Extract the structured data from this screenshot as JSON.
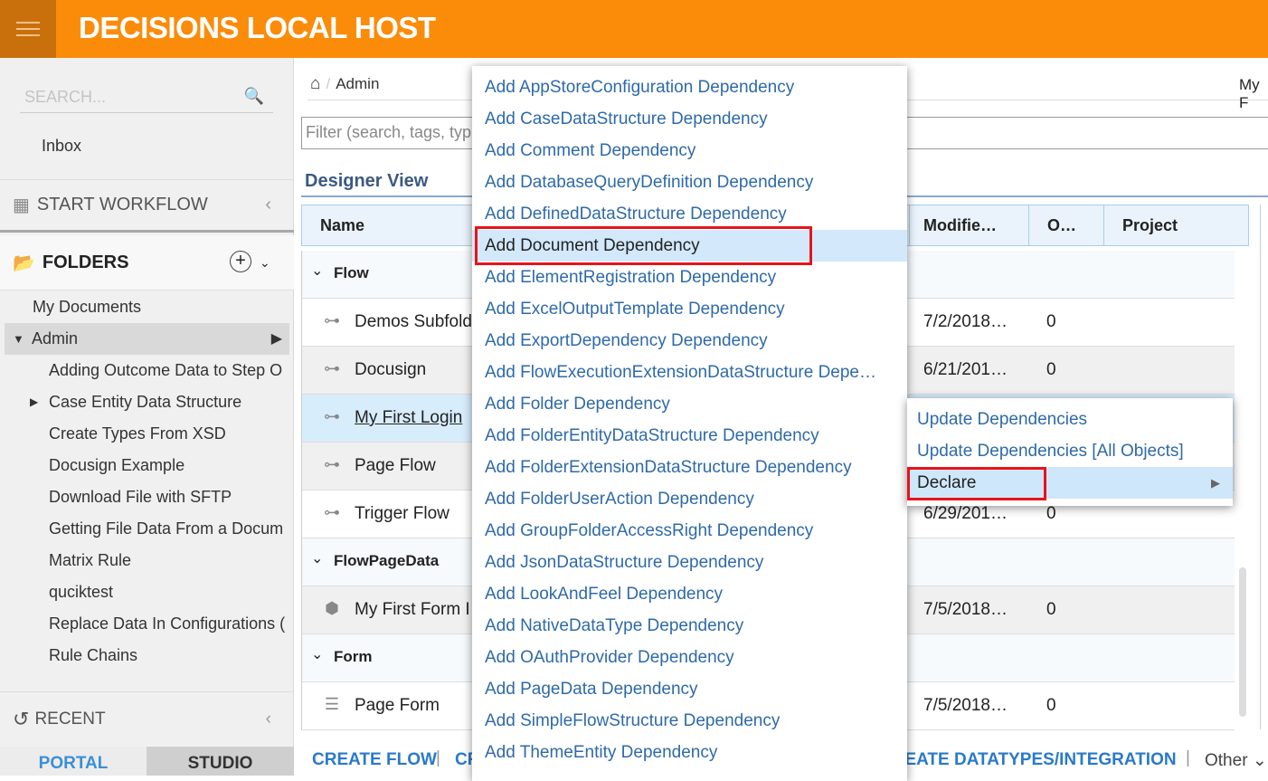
{
  "header": {
    "title": "DECISIONS LOCAL HOST",
    "accent": "#fb8c0a"
  },
  "sidebar": {
    "search_placeholder": "SEARCH...",
    "inbox": "Inbox",
    "start_workflow": "START WORKFLOW",
    "folders": "FOLDERS",
    "tree": [
      {
        "label": "My Documents",
        "indent": 0
      },
      {
        "label": "Admin",
        "indent": 0,
        "selected": true,
        "expanded": true
      },
      {
        "label": "Adding Outcome Data to Step O",
        "indent": 1
      },
      {
        "label": "Case Entity Data Structure",
        "indent": 1,
        "collapsed": true
      },
      {
        "label": "Create Types From XSD",
        "indent": 1
      },
      {
        "label": "Docusign Example",
        "indent": 1
      },
      {
        "label": "Download File with SFTP",
        "indent": 1
      },
      {
        "label": "Getting File Data From a Docum",
        "indent": 1
      },
      {
        "label": "Matrix Rule",
        "indent": 1
      },
      {
        "label": "quciktest",
        "indent": 1
      },
      {
        "label": "Replace Data In Configurations (",
        "indent": 1
      },
      {
        "label": "Rule Chains",
        "indent": 1
      }
    ],
    "recent": "RECENT",
    "tabs": {
      "portal": "PORTAL",
      "studio": "STUDIO"
    }
  },
  "main": {
    "breadcrumb": "Admin",
    "top_right": "My F",
    "filter_placeholder": "Filter (search, tags, typ",
    "view_title": "Designer View",
    "columns": {
      "name": "Name",
      "modified": "Modifie…",
      "owner": "O…",
      "project": "Project"
    },
    "rows": [
      {
        "group": "Flow"
      },
      {
        "name": "Demos Subfold",
        "modified": "7/2/2018…",
        "owner": "0",
        "icon": "flow-icon"
      },
      {
        "name": "Docusign",
        "modified": "6/21/201…",
        "owner": "0",
        "icon": "flow-icon"
      },
      {
        "name": "My First Login",
        "modified": "",
        "owner": "",
        "icon": "flow-icon",
        "selected": true
      },
      {
        "name": "Page Flow",
        "modified": "",
        "owner": "",
        "icon": "flow-icon"
      },
      {
        "name": "Trigger Flow",
        "modified": "6/29/201…",
        "owner": "0",
        "icon": "flow-icon"
      },
      {
        "group": "FlowPageData"
      },
      {
        "name": "My First Form I",
        "modified": "7/5/2018…",
        "owner": "0",
        "icon": "cube-icon"
      },
      {
        "group": "Form"
      },
      {
        "name": "Page Form",
        "modified": "7/5/2018…",
        "owner": "0",
        "icon": "form-icon"
      }
    ],
    "actions": {
      "create_flow": "CREATE FLOW",
      "cr": "CR",
      "create_datatypes": "CREATE DATATYPES/INTEGRATION",
      "other": "Other"
    }
  },
  "context_menu": {
    "items": [
      "Add AppStoreConfiguration Dependency",
      "Add CaseDataStructure Dependency",
      "Add Comment Dependency",
      "Add DatabaseQueryDefinition Dependency",
      "Add DefinedDataStructure Dependency",
      "Add Document Dependency",
      "Add ElementRegistration Dependency",
      "Add ExcelOutputTemplate Dependency",
      "Add ExportDependency Dependency",
      "Add FlowExecutionExtensionDataStructure Dependency",
      "Add Folder Dependency",
      "Add FolderEntityDataStructure Dependency",
      "Add FolderExtensionDataStructure Dependency",
      "Add FolderUserAction Dependency",
      "Add GroupFolderAccessRight Dependency",
      "Add JsonDataStructure Dependency",
      "Add LookAndFeel Dependency",
      "Add NativeDataType Dependency",
      "Add OAuthProvider Dependency",
      "Add PageData Dependency",
      "Add SimpleFlowStructure Dependency",
      "Add ThemeEntity Dependency"
    ],
    "highlighted": "Add Document Dependency"
  },
  "submenu": {
    "items": [
      "Update Dependencies",
      "Update Dependencies [All Objects]",
      "Declare"
    ],
    "highlighted": "Declare"
  }
}
